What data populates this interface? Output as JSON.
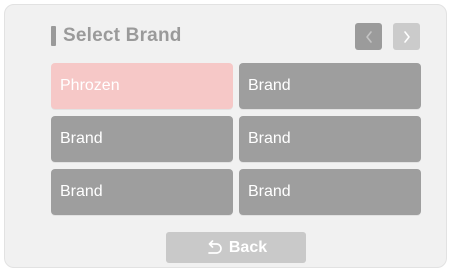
{
  "header": {
    "title": "Select Brand",
    "prev_icon": "chevron-left-icon",
    "next_icon": "chevron-right-icon"
  },
  "brands": [
    {
      "label": "Phrozen",
      "selected": true
    },
    {
      "label": "Brand",
      "selected": false
    },
    {
      "label": "Brand",
      "selected": false
    },
    {
      "label": "Brand",
      "selected": false
    },
    {
      "label": "Brand",
      "selected": false
    },
    {
      "label": "Brand",
      "selected": false
    }
  ],
  "footer": {
    "back_label": "Back",
    "back_icon": "undo-arrow-icon"
  },
  "colors": {
    "panel_bg": "#f1f1f1",
    "brand_button": "#9e9e9e",
    "brand_selected": "#f6c8c7",
    "nav_active": "#9b9b9b",
    "nav_inactive": "#cbcbcb",
    "back_button": "#c9c9c9",
    "title_text": "#9a9a9a"
  }
}
